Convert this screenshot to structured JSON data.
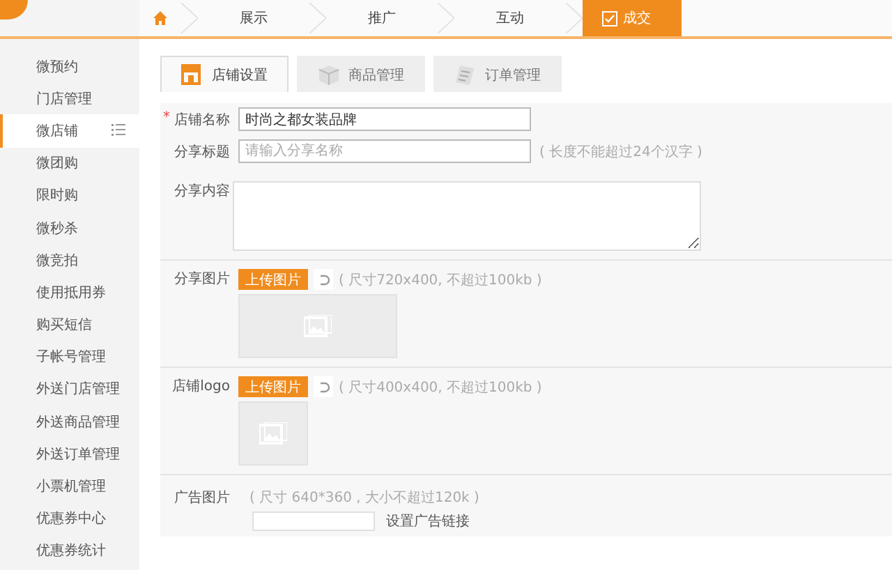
{
  "nav": {
    "steps": [
      {
        "kind": "home",
        "selected": false
      },
      {
        "kind": "step",
        "label": "展示",
        "selected": false
      },
      {
        "kind": "step",
        "label": "推广",
        "selected": false
      },
      {
        "kind": "step",
        "label": "互动",
        "selected": false
      },
      {
        "kind": "step",
        "label": "成交",
        "selected": true
      }
    ]
  },
  "sidebar": {
    "items": [
      {
        "label": "微预约",
        "selected": false
      },
      {
        "label": "门店管理",
        "selected": false
      },
      {
        "label": "微店铺",
        "selected": true
      },
      {
        "label": "微团购",
        "selected": false
      },
      {
        "label": "限时购",
        "selected": false
      },
      {
        "label": "微秒杀",
        "selected": false
      },
      {
        "label": "微竞拍",
        "selected": false
      },
      {
        "label": "使用抵用券",
        "selected": false
      },
      {
        "label": "购买短信",
        "selected": false
      },
      {
        "label": "子帐号管理",
        "selected": false
      },
      {
        "label": "外送门店管理",
        "selected": false
      },
      {
        "label": "外送商品管理",
        "selected": false
      },
      {
        "label": "外送订单管理",
        "selected": false
      },
      {
        "label": "小票机管理",
        "selected": false
      },
      {
        "label": "优惠券中心",
        "selected": false
      },
      {
        "label": "优惠券统计",
        "selected": false
      }
    ]
  },
  "tabs": [
    {
      "label": "店铺设置",
      "selected": true
    },
    {
      "label": "商品管理",
      "selected": false
    },
    {
      "label": "订单管理",
      "selected": false
    }
  ],
  "form": {
    "store_name": {
      "label": "店铺名称",
      "required_mark": "*",
      "value": "时尚之都女装品牌"
    },
    "share_title": {
      "label": "分享标题",
      "placeholder": "请输入分享名称",
      "hint": "( 长度不能超过24个汉字 )"
    },
    "share_content": {
      "label": "分享内容"
    },
    "share_image": {
      "label": "分享图片",
      "button": "上传图片",
      "hint": "( 尺寸720x400, 不超过100kb )"
    },
    "store_logo": {
      "label": "店铺logo",
      "button": "上传图片",
      "hint": "( 尺寸400x400, 不超过100kb )"
    },
    "ad_image": {
      "label": "广告图片",
      "hint": "( 尺寸 640*360 , 大小不超过120k )",
      "link_label": "设置广告链接"
    }
  }
}
